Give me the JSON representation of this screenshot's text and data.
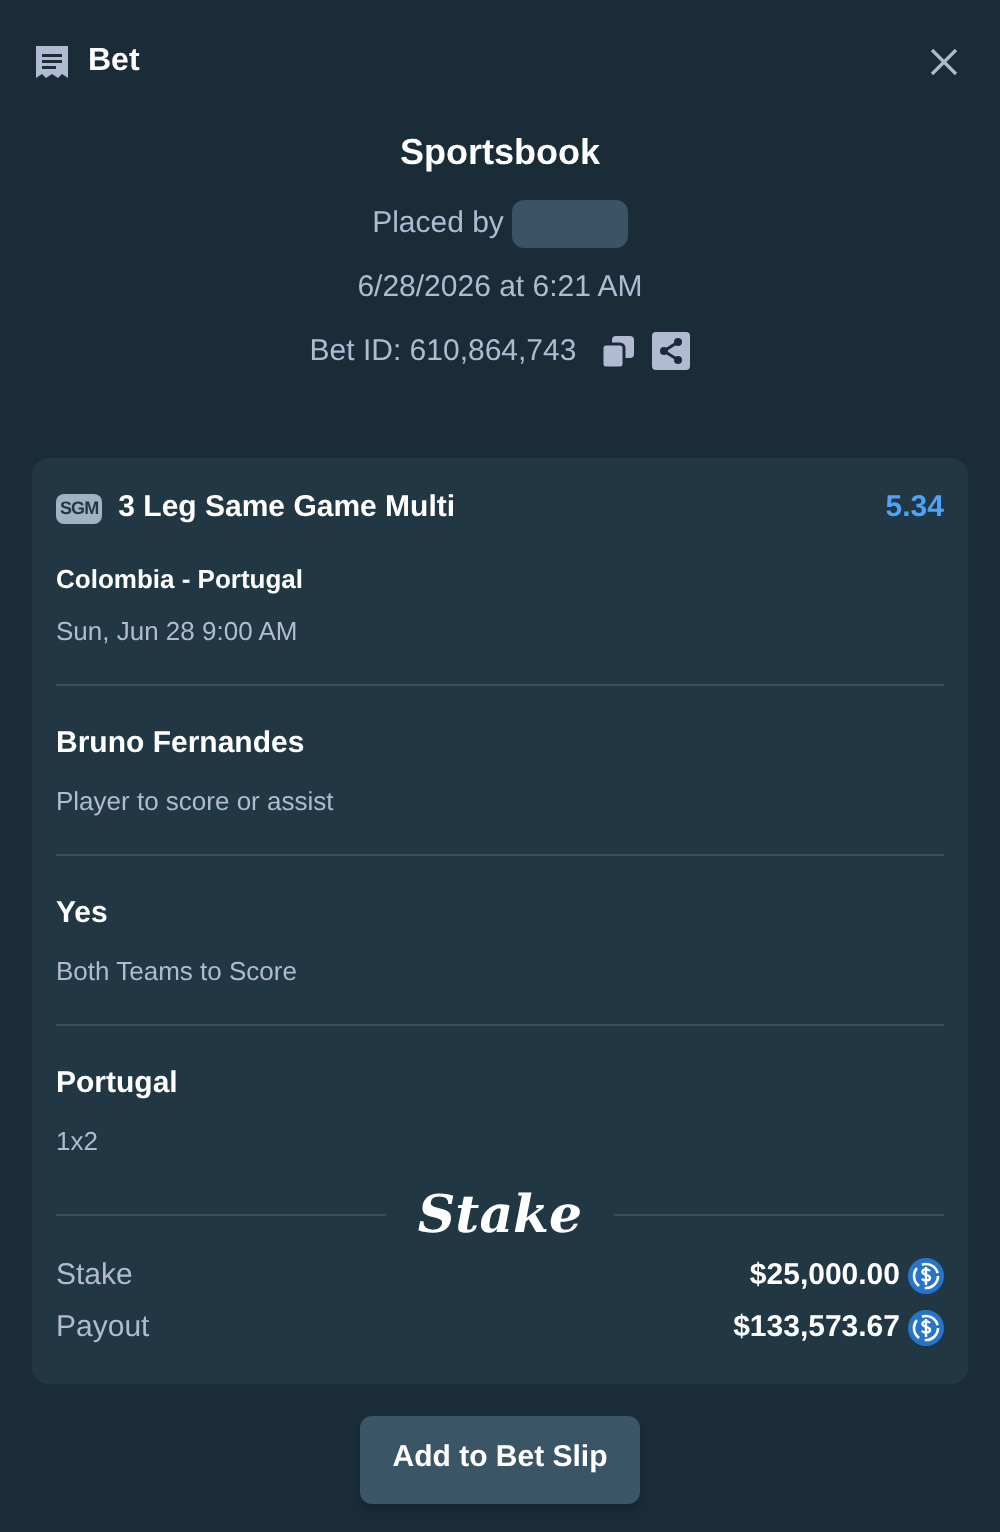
{
  "header": {
    "title": "Bet"
  },
  "summary": {
    "title": "Sportsbook",
    "placed_by": "Placed by",
    "date": "6/28/2026 at 6:21 AM",
    "bet_id": "Bet ID: 610,864,743"
  },
  "bet": {
    "badge": "SGM",
    "title": "3 Leg Same Game Multi",
    "odds": "5.34",
    "event": "Colombia - Portugal",
    "event_time": "Sun, Jun 28 9:00 AM",
    "legs": [
      {
        "selection": "Bruno Fernandes",
        "market": "Player to score or assist"
      },
      {
        "selection": "Yes",
        "market": "Both Teams to Score"
      },
      {
        "selection": "Portugal",
        "market": "1x2"
      }
    ],
    "logo": "Stake",
    "amounts": [
      {
        "label": "Stake",
        "value": "$25,000.00"
      },
      {
        "label": "Payout",
        "value": "$133,573.67"
      }
    ]
  },
  "button": "Add to Bet Slip"
}
